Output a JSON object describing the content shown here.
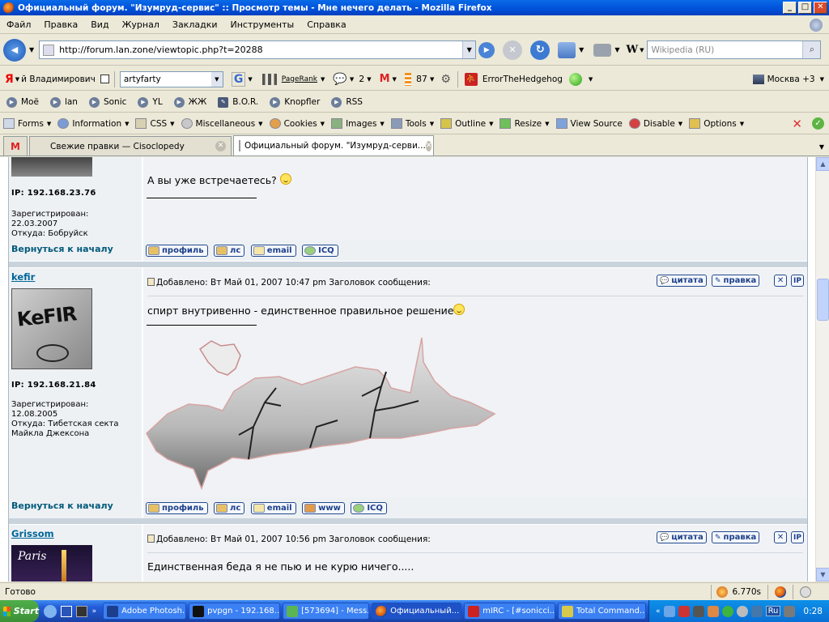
{
  "window": {
    "title": "Официальный форум. \"Изумруд-сервис\" :: Просмотр темы - Мне нечего делать - Mozilla Firefox",
    "min": "_",
    "max": "□",
    "close": "✕"
  },
  "menu": [
    {
      "label": "Файл"
    },
    {
      "label": "Правка"
    },
    {
      "label": "Вид"
    },
    {
      "label": "Журнал"
    },
    {
      "label": "Закладки"
    },
    {
      "label": "Инструменты"
    },
    {
      "label": "Справка"
    }
  ],
  "nav": {
    "url": "http://forum.lan.zone/viewtopic.php?t=20288",
    "search_engine": "W",
    "search_placeholder": "Wikipedia (RU)"
  },
  "toolbar3": {
    "yandex_label": "й Владимирович",
    "user_field": "artyfarty",
    "google": "G",
    "pagerank": "PageRank",
    "comments_count": "2",
    "mail_letter": "M",
    "rss_count": "87",
    "error_label": "ErrorTheHedgehog",
    "weather": "Москва +3"
  },
  "bookmarks": [
    {
      "label": "Моё"
    },
    {
      "label": "lan"
    },
    {
      "label": "Sonic"
    },
    {
      "label": "YL"
    },
    {
      "label": "ЖЖ"
    },
    {
      "label": "B.O.R."
    },
    {
      "label": "Knopfler"
    },
    {
      "label": "RSS"
    }
  ],
  "webdev": [
    {
      "label": "Forms"
    },
    {
      "label": "Information"
    },
    {
      "label": "CSS"
    },
    {
      "label": "Miscellaneous"
    },
    {
      "label": "Cookies"
    },
    {
      "label": "Images"
    },
    {
      "label": "Tools"
    },
    {
      "label": "Outline"
    },
    {
      "label": "Resize"
    },
    {
      "label": "View Source"
    },
    {
      "label": "Disable"
    },
    {
      "label": "Options"
    }
  ],
  "tabs": [
    {
      "label": "Свежие правки — Cisoclopedy"
    },
    {
      "label": "Официальный форум. \"Изумруд-серви..."
    }
  ],
  "buttons": {
    "profile": "профиль",
    "pm": "лс",
    "email": "email",
    "icq": "ICQ",
    "www": "www",
    "quote": "цитата",
    "edit": "правка",
    "delete": "✕",
    "ip": "IP"
  },
  "posts": [
    {
      "ip": "IP: 192.168.23.76",
      "registered": "Зарегистрирован:",
      "reg_date": "22.03.2007",
      "location": "Откуда: Бобруйск",
      "message": "А вы уже встречаетесь?",
      "back": "Вернуться к началу"
    },
    {
      "username": "kefir",
      "avatar_text": "KeFIR",
      "ip": "IP: 192.168.21.84",
      "registered": "Зарегистрирован:",
      "reg_date": "12.08.2005",
      "location": "Откуда: Тибетская секта Майкла Джексона",
      "header": "Добавлено: Вт Май 01, 2007 10:47 pm     Заголовок сообщения:",
      "message": "спирт внутривенно - единственное правильное решение",
      "back": "Вернуться к началу"
    },
    {
      "username": "Grissom",
      "avatar_text": "Paris",
      "header": "Добавлено: Вт Май 01, 2007 10:56 pm     Заголовок сообщения:",
      "message": "Единственная беда я не пью и не курю ничего....."
    }
  ],
  "status": {
    "text": "Готово",
    "timer": "6.770s"
  },
  "taskbar": {
    "start": "Start",
    "tasks": [
      {
        "label": "Adobe Photosh..."
      },
      {
        "label": "pvpgn - 192.168...."
      },
      {
        "label": "[573694] - Mess..."
      },
      {
        "label": "Официальный..."
      },
      {
        "label": "mIRC - [#sonicci..."
      },
      {
        "label": "Total Command..."
      }
    ],
    "lang": "Ru",
    "clock": "0:28"
  }
}
